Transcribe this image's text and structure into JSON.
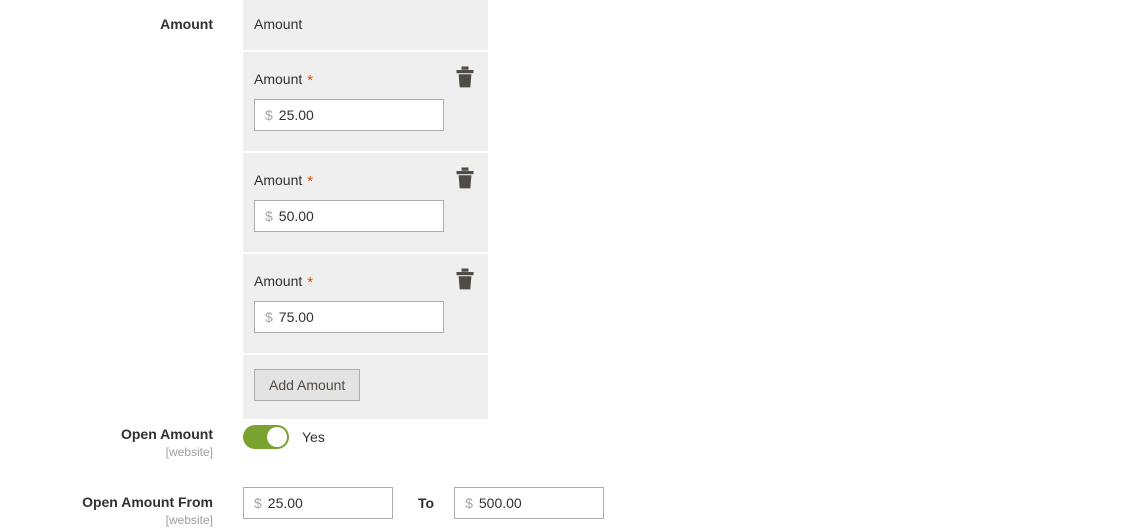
{
  "form": {
    "amount_field": {
      "label": "Amount",
      "panel_header": "Amount",
      "row_label": "Amount",
      "required_mark": "*",
      "currency_symbol": "$",
      "rows": [
        {
          "value": "25.00"
        },
        {
          "value": "50.00"
        },
        {
          "value": "75.00"
        }
      ],
      "add_button_label": "Add Amount",
      "delete_icon": "trash-icon"
    },
    "open_amount": {
      "label": "Open Amount",
      "scope": "[website]",
      "toggle_state": "Yes",
      "toggle_on": true
    },
    "open_amount_from": {
      "label": "Open Amount From",
      "scope": "[website]",
      "currency_symbol": "$",
      "from_value": "25.00",
      "to_label": "To",
      "to_value": "500.00"
    }
  },
  "colors": {
    "panel_bg": "#efefef",
    "toggle_on": "#79a22e",
    "required": "#e04f00",
    "text": "#303030",
    "scope_text": "#9e9e9e"
  }
}
